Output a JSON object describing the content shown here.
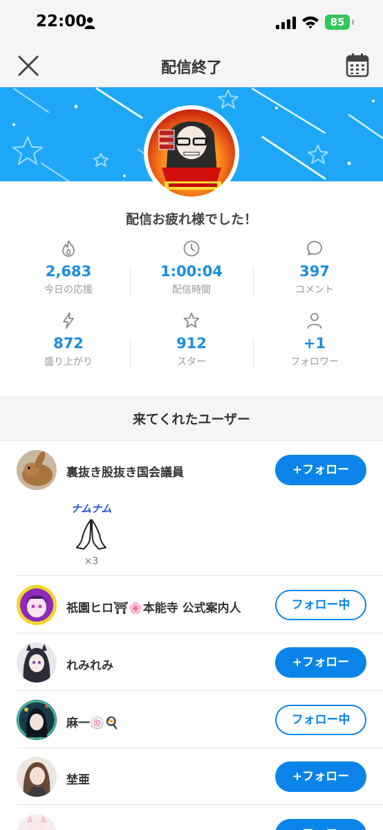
{
  "status_bar": {
    "time": "22:00",
    "battery": "85"
  },
  "header": {
    "title": "配信終了"
  },
  "main": {
    "thanks": "配信お疲れ様でした！"
  },
  "stats": [
    {
      "icon": "flame-icon",
      "value": "2,683",
      "label": "今日の応援"
    },
    {
      "icon": "clock-icon",
      "value": "1:00:04",
      "label": "配信時間"
    },
    {
      "icon": "chat-bubble-icon",
      "value": "397",
      "label": "コメント"
    },
    {
      "icon": "lightning-icon",
      "value": "872",
      "label": "盛り上がり"
    },
    {
      "icon": "star-icon",
      "value": "912",
      "label": "スター"
    },
    {
      "icon": "person-icon",
      "value": "+1",
      "label": "フォロワー"
    }
  ],
  "visitors": {
    "heading": "来てくれたユーザー",
    "users": [
      {
        "name": "裏抜き股抜き国会議員",
        "button": "+フォロー",
        "state": "follow"
      },
      {
        "name": "祇園ヒロ⛩🌸本能寺 公式案内人",
        "button": "フォロー中",
        "state": "following"
      },
      {
        "name": "れみれみ",
        "button": "+フォロー",
        "state": "follow"
      },
      {
        "name": "麻一🍥🍳",
        "button": "フォロー中",
        "state": "following"
      },
      {
        "name": "埜亜",
        "button": "+フォロー",
        "state": "follow"
      },
      {
        "name": "",
        "button": "+フォロー",
        "state": "follow"
      }
    ],
    "gift": {
      "text": "ナムナム",
      "count": "×3",
      "icon": "praying-hands-icon"
    }
  },
  "colors": {
    "accent": "#0a84e8",
    "stat_value": "#1a8de0",
    "banner": "#1fa7f7",
    "battery": "#34c759"
  }
}
